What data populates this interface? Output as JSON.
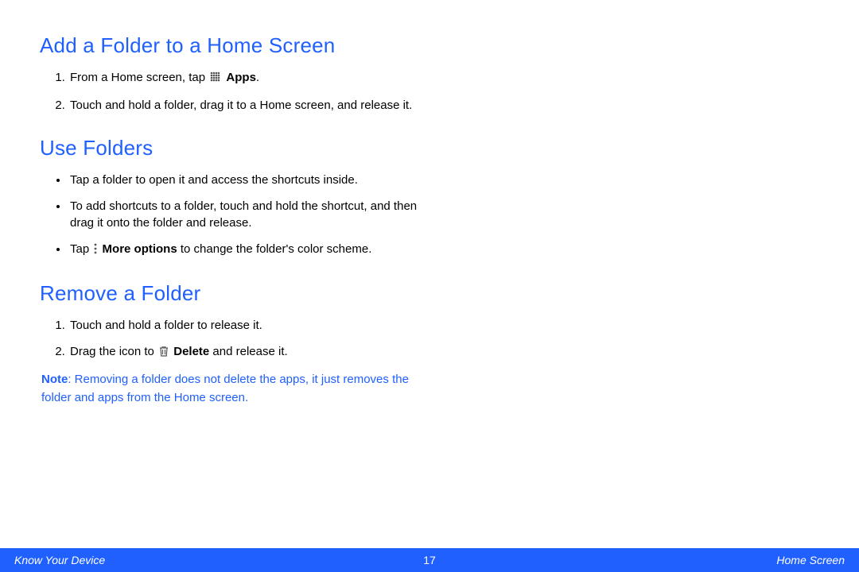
{
  "sections": [
    {
      "title": "Add a Folder to a Home Screen",
      "type": "ol",
      "items": [
        {
          "parts": [
            "From a Home screen, tap ",
            {
              "icon": "grid"
            },
            " ",
            {
              "bold": "Apps"
            },
            "."
          ]
        },
        {
          "parts": [
            "Touch and hold a folder, drag it to a Home screen, and release it."
          ]
        }
      ]
    },
    {
      "title": "Use Folders",
      "type": "ul",
      "items": [
        {
          "parts": [
            "Tap a folder to open it and access the shortcuts inside."
          ]
        },
        {
          "parts": [
            "To add shortcuts to a folder, touch and hold the shortcut, and then drag it onto the folder and release."
          ]
        },
        {
          "parts": [
            "Tap ",
            {
              "icon": "dots"
            },
            " ",
            {
              "bold": "More options"
            },
            " to change the folder's color scheme."
          ]
        }
      ]
    },
    {
      "title": "Remove a Folder",
      "type": "ol",
      "items": [
        {
          "parts": [
            "Touch and hold a folder to release it."
          ]
        },
        {
          "parts": [
            "Drag the icon to ",
            {
              "icon": "trash"
            },
            " ",
            {
              "bold": "Delete"
            },
            " and release it."
          ]
        }
      ],
      "note": {
        "label": "Note",
        "text": ": Removing a folder does not delete the apps, it just removes the folder and apps from the Home screen."
      }
    }
  ],
  "footer": {
    "left": "Know Your Device",
    "center": "17",
    "right": "Home Screen"
  },
  "icons": {
    "grid": "apps-grid-icon",
    "dots": "more-options-icon",
    "trash": "delete-trash-icon"
  }
}
